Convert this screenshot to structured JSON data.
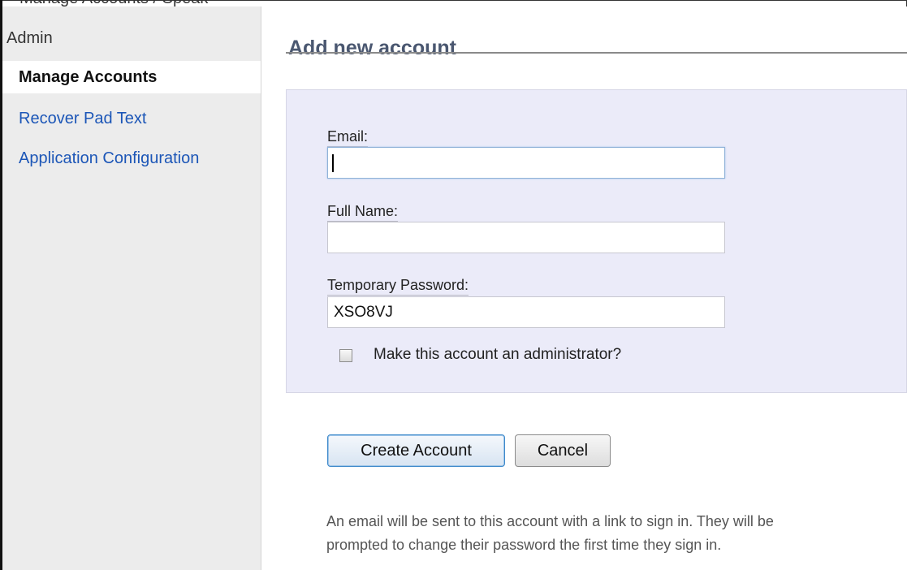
{
  "clipped_top_text": "Manage Accounts / Speak",
  "sidebar": {
    "header": "Admin",
    "items": [
      {
        "label": "Manage Accounts",
        "active": true
      },
      {
        "label": "Recover Pad Text",
        "active": false
      },
      {
        "label": "Application Configuration",
        "active": false
      }
    ]
  },
  "main": {
    "title": "Add new account",
    "form": {
      "email": {
        "label": "Email:",
        "value": ""
      },
      "full_name": {
        "label": "Full Name:",
        "value": ""
      },
      "temp_password": {
        "label": "Temporary Password:",
        "value": "XSO8VJ"
      },
      "admin_checkbox": {
        "label": "Make this account an administrator?",
        "checked": false
      }
    },
    "buttons": {
      "create": "Create Account",
      "cancel": "Cancel"
    },
    "note": "An email will be sent to this account with a link to sign in. They will be prompted to change their password the first time they sign in."
  },
  "colors": {
    "sidebar_background": "#ececec",
    "link": "#1c56b7",
    "title": "#4a5770",
    "form_panel": "#ebebf9"
  }
}
